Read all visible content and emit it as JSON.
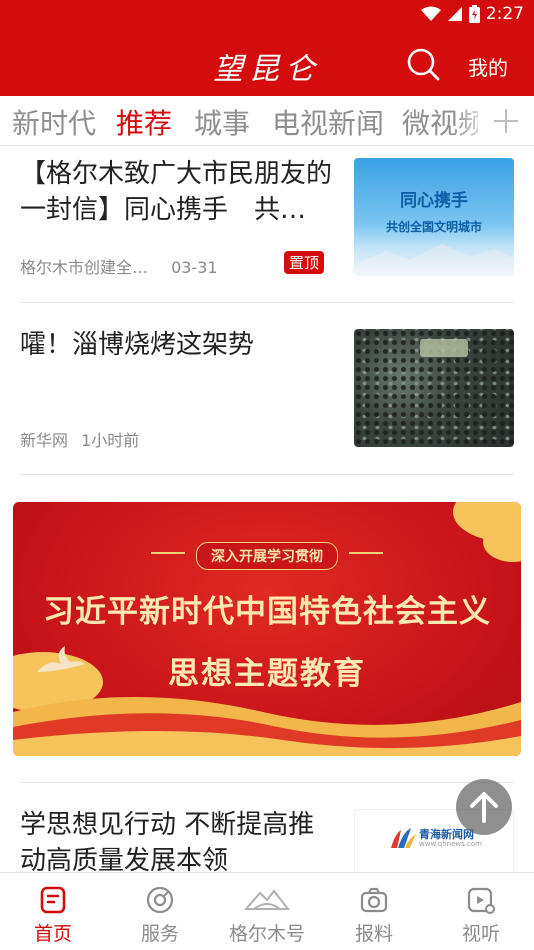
{
  "status_bar": {
    "time": "2:27"
  },
  "header": {
    "title": "望昆仑",
    "mine_label": "我的"
  },
  "tabs": [
    {
      "label": "新时代",
      "active": false
    },
    {
      "label": "推荐",
      "active": true
    },
    {
      "label": "城事",
      "active": false
    },
    {
      "label": "电视新闻",
      "active": false
    },
    {
      "label": "微视频",
      "active": false
    }
  ],
  "news": [
    {
      "title": "【格尔木致广大市民朋友的一封信】同心携手　共…",
      "source": "格尔木市创建全…",
      "time": "03-31",
      "badge": "置顶",
      "thumb_text_1": "同心携手",
      "thumb_text_2": "共创全国文明城市"
    },
    {
      "title": "嚯！淄博烧烤这架势",
      "source": "新华网",
      "time": "1小时前"
    },
    {
      "title": "学思想见行动 不断提高推动高质量发展本领",
      "thumb_text_1": "青海新闻网",
      "thumb_text_2": "www.qhnews.com"
    }
  ],
  "banner": {
    "subtitle": "深入开展学习贯彻",
    "line1": "习近平新时代中国特色社会主义",
    "line2": "思想主题教育"
  },
  "bottom_nav": [
    {
      "label": "首页",
      "icon": "home-doc-icon",
      "active": true
    },
    {
      "label": "服务",
      "icon": "compass-icon",
      "active": false
    },
    {
      "label": "格尔木号",
      "icon": "mountain-icon",
      "active": false
    },
    {
      "label": "报料",
      "icon": "camera-icon",
      "active": false
    },
    {
      "label": "视听",
      "icon": "video-music-icon",
      "active": false
    }
  ],
  "colors": {
    "brand_red": "#d50c0d",
    "inactive_gray": "#8c8c8c"
  }
}
